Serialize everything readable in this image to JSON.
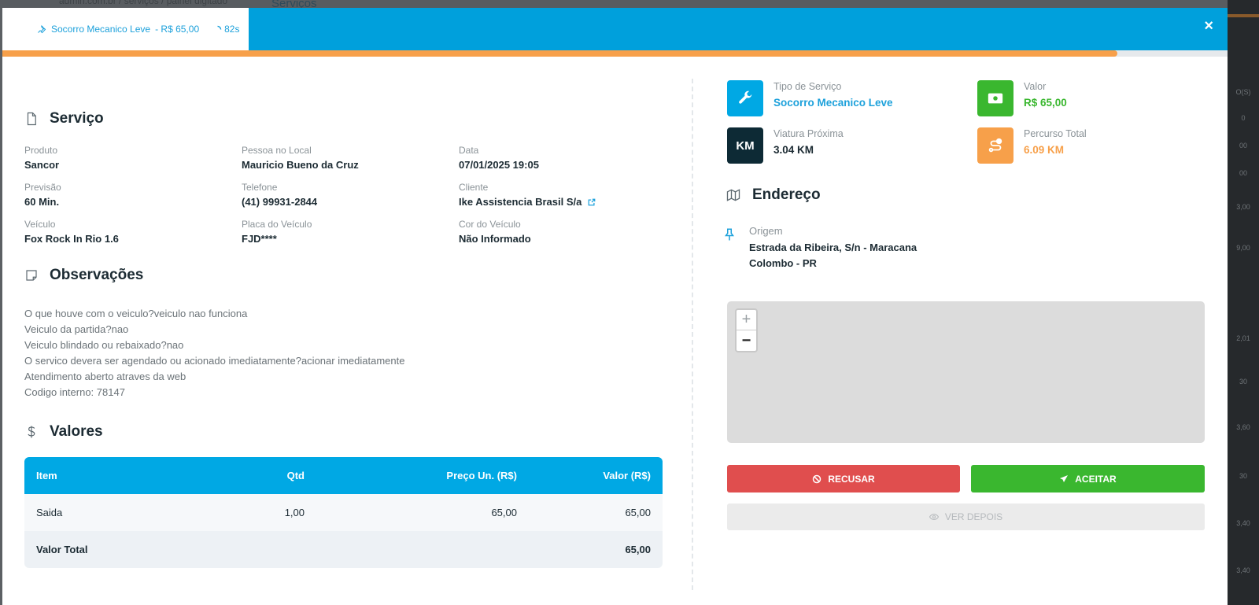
{
  "background": {
    "breadcrumb": "admin.com.br  /  serviços  /  painel digitado",
    "title": "Serviços",
    "side_numbers": [
      "O(S)",
      "0",
      "00",
      "00",
      "3,00",
      "9,00",
      "2,01",
      "30",
      "3,60",
      "30",
      "3,40",
      "3,40"
    ]
  },
  "header": {
    "service_label": "Socorro Mecanico Leve",
    "price_label": "- R$ 65,00",
    "timer": "82s",
    "close_label": "×",
    "progress_fraction": 0.91
  },
  "servico": {
    "title": "Serviço",
    "fields": [
      {
        "label": "Produto",
        "value": "Sancor"
      },
      {
        "label": "Pessoa no Local",
        "value": "Mauricio Bueno da Cruz"
      },
      {
        "label": "Data",
        "value": "07/01/2025 19:05"
      },
      {
        "label": "Previsão",
        "value": "60 Min."
      },
      {
        "label": "Telefone",
        "value": "(41) 99931-2844"
      },
      {
        "label": "Cliente",
        "value": "Ike Assistencia Brasil S/a"
      },
      {
        "label": "Veículo",
        "value": "Fox Rock In Rio 1.6"
      },
      {
        "label": "Placa do Veículo",
        "value": "FJD****"
      },
      {
        "label": "Cor do Veículo",
        "value": "Não Informado"
      }
    ]
  },
  "observacoes": {
    "title": "Observações",
    "lines": [
      "O que houve com o veiculo?veiculo nao funciona",
      "Veiculo da partida?nao",
      "Veiculo blindado ou rebaixado?nao",
      "O servico devera ser agendado ou acionado imediatamente?acionar imediatamente",
      "Atendimento aberto atraves da web",
      "Codigo interno: 78147"
    ]
  },
  "valores": {
    "title": "Valores",
    "headers": [
      "Item",
      "Qtd",
      "Preço Un. (R$)",
      "Valor (R$)"
    ],
    "rows": [
      {
        "item": "Saida",
        "qtd": "1,00",
        "preco": "65,00",
        "valor": "65,00"
      }
    ],
    "total_label": "Valor Total",
    "total_value": "65,00"
  },
  "info": {
    "tipo": {
      "label": "Tipo de Serviço",
      "value": "Socorro Mecanico Leve",
      "color": "#00a8e4",
      "icon": "wrench-icon"
    },
    "valor": {
      "label": "Valor",
      "value": "R$ 65,00",
      "color": "#3ab72f",
      "icon": "money-icon"
    },
    "viatura": {
      "label": "Viatura Próxima",
      "value": "3.04 KM",
      "badge": "KM",
      "color": "#0d2a35",
      "icon": "km-icon"
    },
    "percurso": {
      "label": "Percurso Total",
      "value": "6.09 KM",
      "color": "#f7a04a",
      "icon": "route-icon"
    }
  },
  "endereco": {
    "title": "Endereço",
    "origem_label": "Origem",
    "line1": "Estrada da Ribeira, S/n - Maracana",
    "line2": "Colombo - PR"
  },
  "map": {
    "zoom_in": "+",
    "zoom_out": "−"
  },
  "actions": {
    "refuse": "RECUSAR",
    "accept": "ACEITAR",
    "later": "VER DEPOIS"
  }
}
